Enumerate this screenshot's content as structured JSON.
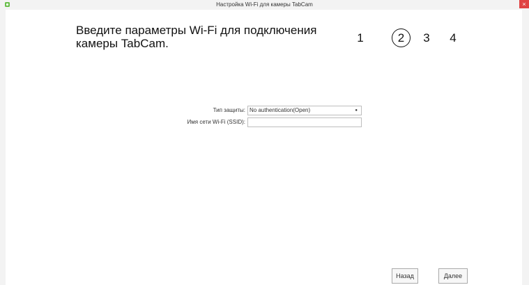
{
  "window": {
    "title": "Настройка Wi-Fi для камеры TabCam",
    "close_glyph": "×",
    "icons": {
      "app": "app-icon",
      "close": "close-icon"
    }
  },
  "heading": "Введите параметры Wi-Fi для подключения камеры TabCam.",
  "steps": [
    {
      "label": "1",
      "current": false
    },
    {
      "label": "2",
      "current": true
    },
    {
      "label": "3",
      "current": false
    },
    {
      "label": "4",
      "current": false
    }
  ],
  "form": {
    "security_label": "Тип защиты:",
    "security_value": "No authentication(Open)",
    "ssid_label": "Имя сети Wi-Fi (SSID):",
    "ssid_value": ""
  },
  "buttons": {
    "back": "Назад",
    "next": "Далее"
  },
  "colors": {
    "close_button": "#e04343",
    "frame": "#f3f3f3"
  }
}
